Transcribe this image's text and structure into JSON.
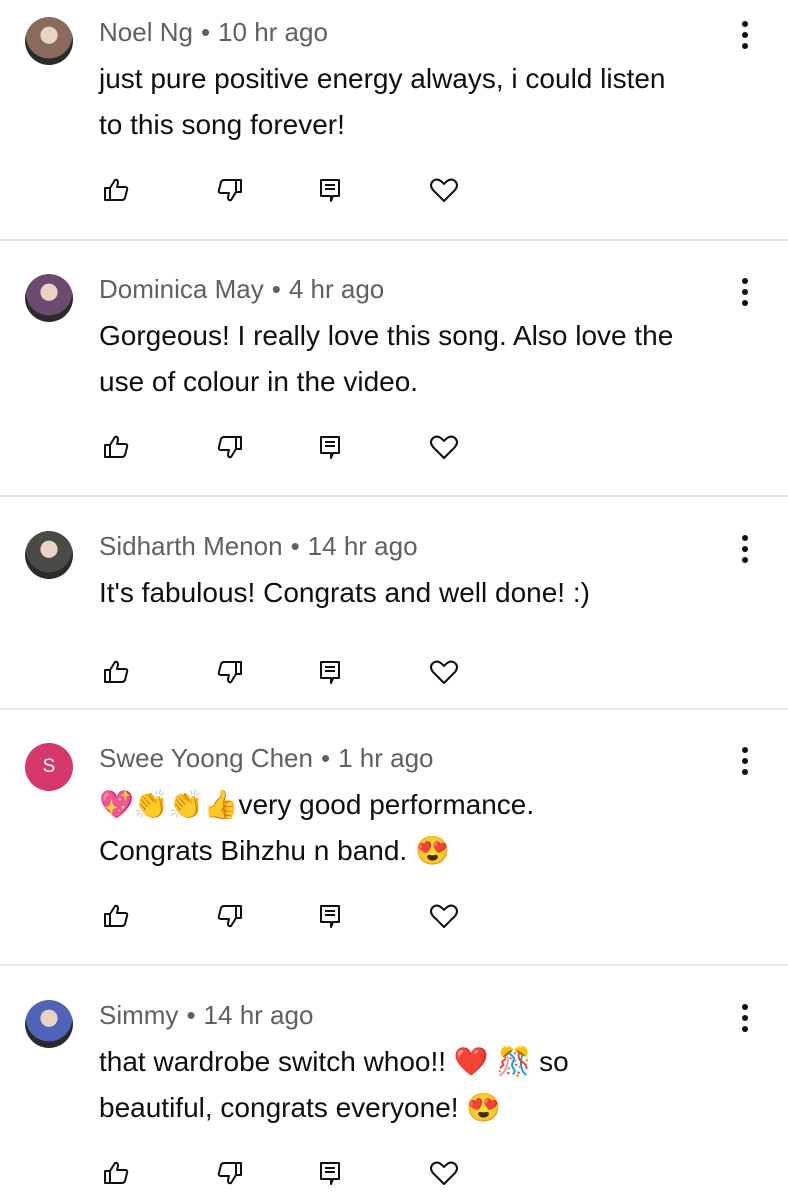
{
  "comments": [
    {
      "author": "Noel Ng",
      "time": "10 hr ago",
      "text_lines": [
        "just pure positive energy always, i could listen",
        "to this song forever!"
      ],
      "avatar": {
        "type": "image",
        "color": "#8a6a5c"
      }
    },
    {
      "author": "Dominica May",
      "time": "4 hr ago",
      "text_lines": [
        "Gorgeous! I really love this song. Also love the",
        "use of colour in the video."
      ],
      "avatar": {
        "type": "image",
        "color": "#6b4a6e"
      }
    },
    {
      "author": "Sidharth Menon",
      "time": "14 hr ago",
      "text_lines": [
        "It's fabulous! Congrats and well done! :)"
      ],
      "avatar": {
        "type": "image",
        "color": "#4a4a46"
      }
    },
    {
      "author": "Swee Yoong Chen",
      "time": "1 hr ago",
      "text_lines": [
        "💖👏👏👍very good performance.",
        "Congrats Bihzhu n band. 😍"
      ],
      "avatar": {
        "type": "letter",
        "letter": "S",
        "color": "#d6386d"
      }
    },
    {
      "author": "Simmy",
      "time": "14 hr ago",
      "text_lines": [
        "that wardrobe switch whoo!! ❤️ 🎊 so",
        "beautiful, congrats everyone! 😍"
      ],
      "avatar": {
        "type": "image",
        "color": "#4f63b8"
      }
    }
  ],
  "icons": {
    "like": "thumbs-up-icon",
    "dislike": "thumbs-down-icon",
    "reply": "reply-icon",
    "heart": "heart-icon",
    "more": "more-vertical-icon"
  },
  "colors": {
    "meta_text": "#606060",
    "body_text": "#0f0f0f",
    "divider": "#e5e5e5"
  }
}
